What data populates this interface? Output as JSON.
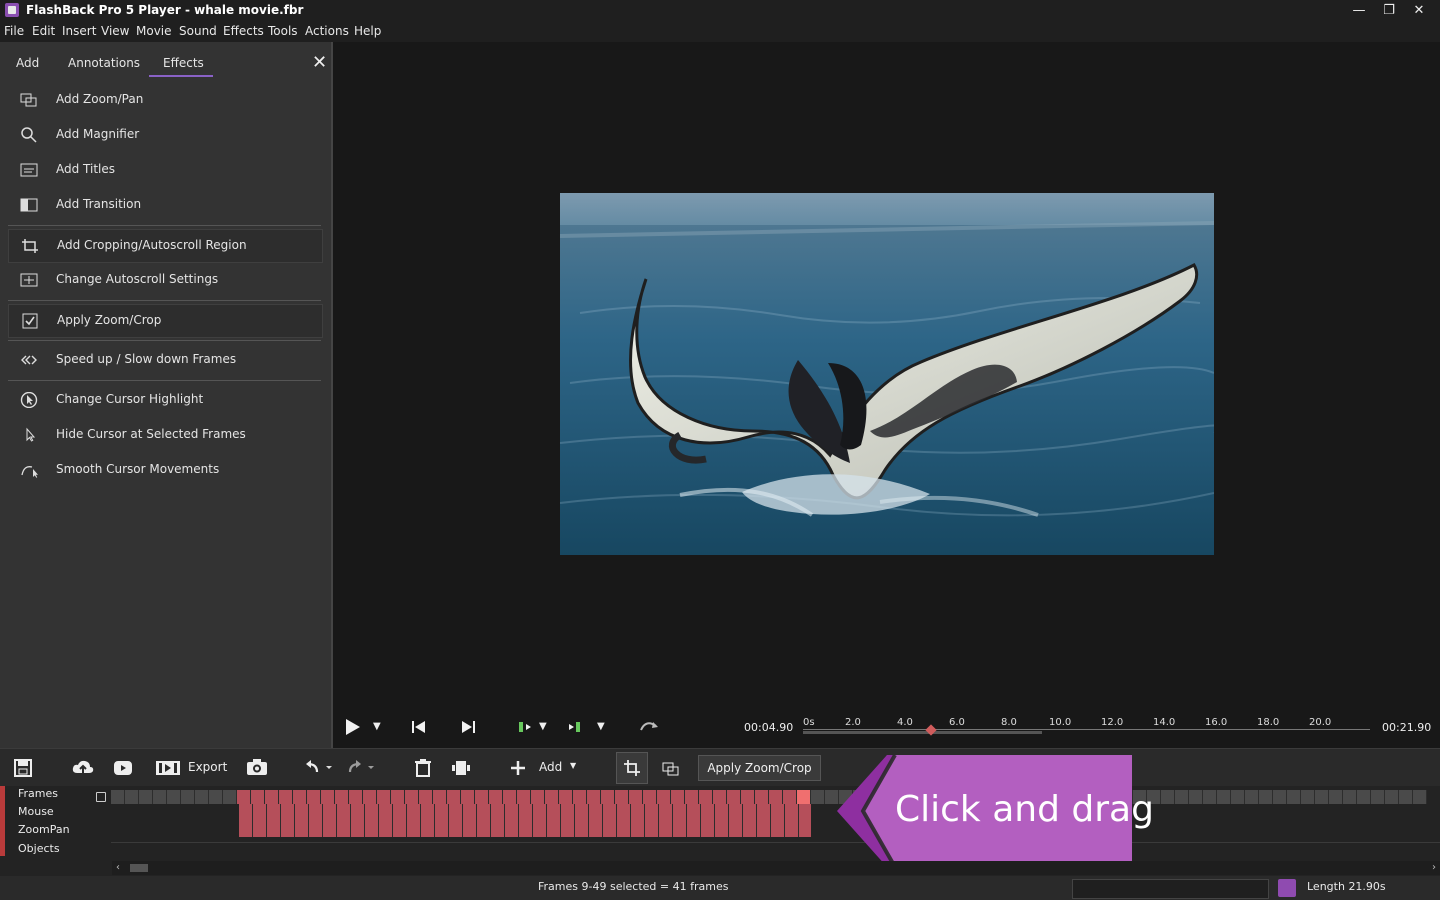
{
  "window": {
    "title": "FlashBack Pro 5 Player - whale movie.fbr",
    "controls": [
      "minimize-icon",
      "restore-icon",
      "close-icon"
    ]
  },
  "menu": [
    "File",
    "Edit",
    "Insert",
    "View",
    "Movie",
    "Sound",
    "Effects",
    "Tools",
    "Actions",
    "Help"
  ],
  "left_panel": {
    "tabs": [
      "Add",
      "Annotations",
      "Effects"
    ],
    "active_tab": "Effects",
    "items": [
      {
        "label": "Add Zoom/Pan",
        "icon": "zoom-pan-icon"
      },
      {
        "label": "Add Magnifier",
        "icon": "magnifier-icon"
      },
      {
        "label": "Add Titles",
        "icon": "titles-icon"
      },
      {
        "label": "Add Transition",
        "icon": "transition-icon"
      },
      {
        "label": "Add Cropping/Autoscroll Region",
        "icon": "crop-icon"
      },
      {
        "label": "Change Autoscroll Settings",
        "icon": "autoscroll-icon"
      },
      {
        "label": "Apply Zoom/Crop",
        "icon": "checkbox-icon"
      },
      {
        "label": "Speed up / Slow down Frames",
        "icon": "speed-icon"
      },
      {
        "label": "Change Cursor Highlight",
        "icon": "cursor-highlight-icon"
      },
      {
        "label": "Hide Cursor at Selected Frames",
        "icon": "cursor-icon"
      },
      {
        "label": "Smooth Cursor Movements",
        "icon": "smooth-cursor-icon"
      }
    ]
  },
  "playback": {
    "current_time": "00:04.90",
    "total_time": "00:21.90",
    "ticks": [
      "0s",
      "2.0",
      "4.0",
      "6.0",
      "8.0",
      "10.0",
      "12.0",
      "14.0",
      "16.0",
      "18.0",
      "20.0"
    ],
    "position_fraction": 0.224
  },
  "toolbar": {
    "export_label": "Export",
    "add_label": "Add",
    "apply_label": "Apply Zoom/Crop"
  },
  "timeline": {
    "tracks": [
      "Frames",
      "Mouse",
      "ZoomPan",
      "Objects"
    ],
    "selected_start": 9,
    "selected_end": 49,
    "selected_count": 41
  },
  "callout": {
    "text": "Click and drag"
  },
  "status": {
    "selection": "Frames 9-49 selected = 41 frames",
    "length": "Length 21.90s"
  },
  "colors": {
    "accent": "#8a62c7",
    "selection": "#b54f5a",
    "callout": "#b25fc0"
  }
}
